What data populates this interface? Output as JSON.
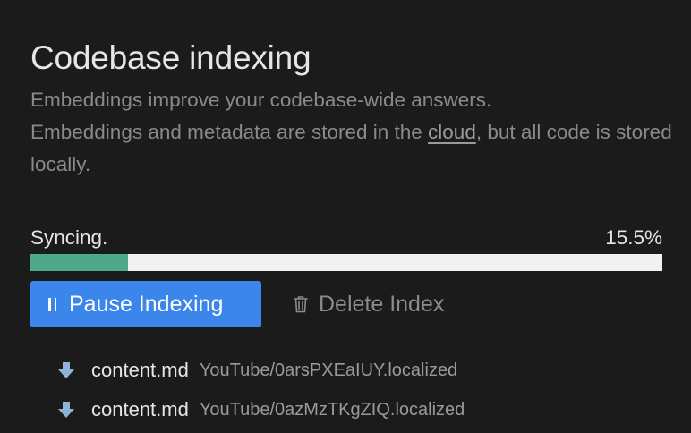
{
  "header": {
    "title": "Codebase indexing"
  },
  "description": {
    "line1": "Embeddings improve your codebase-wide answers.",
    "line2_before": "Embeddings and metadata are stored in the ",
    "link_text": "cloud",
    "line2_after": ", but all code is stored locally."
  },
  "sync": {
    "status": "Syncing.",
    "percent_label": "15.5%",
    "progress": 0.155,
    "fill_color": "#4ea88b",
    "track_color": "#f1f1f1"
  },
  "actions": {
    "pause_label": "Pause Indexing",
    "pause_icon": "pause-icon",
    "delete_label": "Delete Index",
    "delete_icon": "trash-icon",
    "accent_color": "#3a86ea"
  },
  "files": [
    {
      "icon": "download-arrow-icon",
      "name": "content.md",
      "path": "YouTube/0arsPXEaIUY.localized"
    },
    {
      "icon": "download-arrow-icon",
      "name": "content.md",
      "path": "YouTube/0azMzTKgZIQ.localized"
    }
  ]
}
